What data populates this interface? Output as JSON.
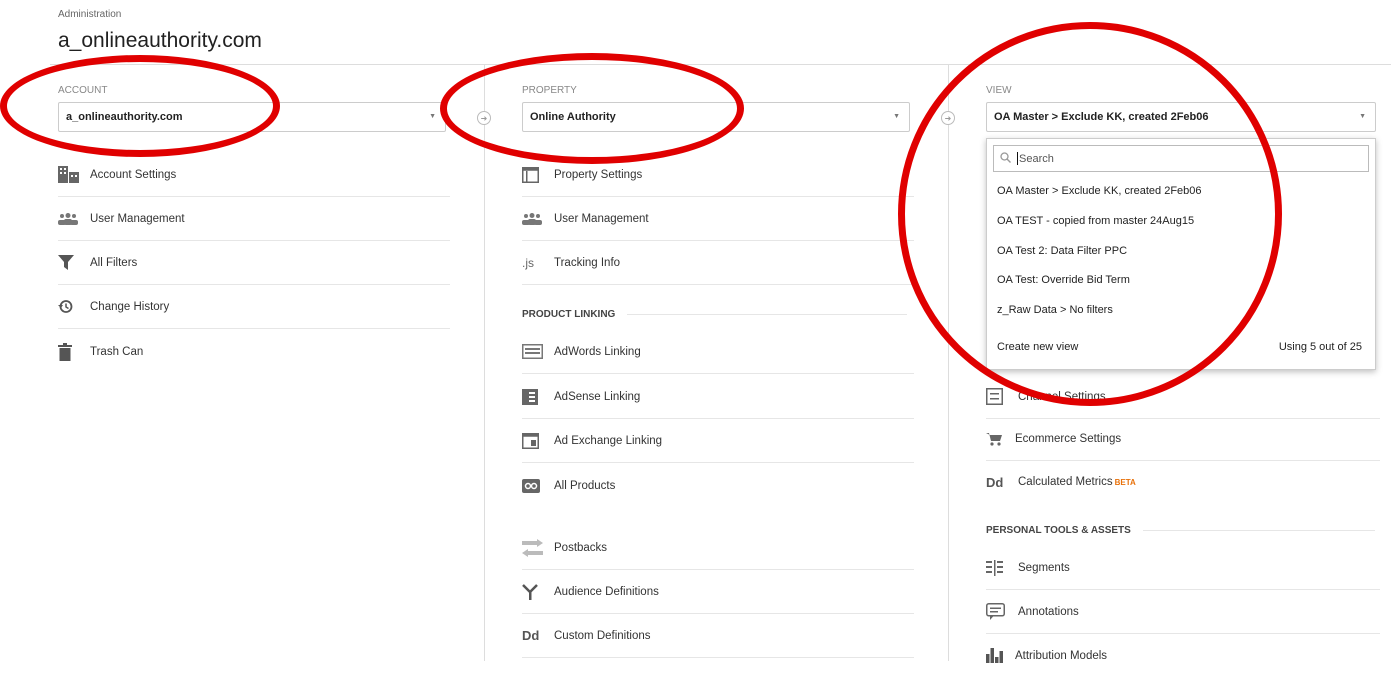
{
  "header": {
    "breadcrumb": "Administration",
    "title": "a_onlineauthority.com"
  },
  "account": {
    "label": "ACCOUNT",
    "selected": "a_onlineauthority.com",
    "items": [
      {
        "label": "Account Settings",
        "icon": "building-icon"
      },
      {
        "label": "User Management",
        "icon": "users-icon"
      },
      {
        "label": "All Filters",
        "icon": "filter-icon"
      },
      {
        "label": "Change History",
        "icon": "history-icon"
      },
      {
        "label": "Trash Can",
        "icon": "trash-icon"
      }
    ]
  },
  "property": {
    "label": "PROPERTY",
    "selected": "Online Authority",
    "items": [
      {
        "label": "Property Settings",
        "icon": "settings-window-icon"
      },
      {
        "label": "User Management",
        "icon": "users-icon"
      },
      {
        "label": "Tracking Info",
        "icon": "js-icon"
      }
    ],
    "section_product_linking": "PRODUCT LINKING",
    "linking": [
      {
        "label": "AdWords Linking",
        "icon": "adwords-icon"
      },
      {
        "label": "AdSense Linking",
        "icon": "adsense-icon"
      },
      {
        "label": "Ad Exchange Linking",
        "icon": "adexchange-icon"
      },
      {
        "label": "All Products",
        "icon": "link-products-icon"
      }
    ],
    "more": [
      {
        "label": "Postbacks",
        "icon": "postbacks-icon"
      },
      {
        "label": "Audience Definitions",
        "icon": "audience-icon"
      },
      {
        "label": "Custom Definitions",
        "icon": "dd-icon"
      }
    ]
  },
  "view": {
    "label": "VIEW",
    "selected": "OA Master > Exclude KK, created 2Feb06",
    "dropdown": {
      "search_placeholder": "Search",
      "search_first_letter": "S",
      "search_rest": "earch",
      "options": [
        "OA Master > Exclude KK, created 2Feb06",
        "OA TEST - copied from master 24Aug15",
        "OA Test 2: Data Filter PPC",
        "OA Test: Override Bid Term",
        "z_Raw Data > No filters"
      ],
      "create": "Create new view",
      "usage": "Using 5 out of 25"
    },
    "items": [
      {
        "label": "Channel Settings",
        "icon": "channel-icon"
      },
      {
        "label": "Ecommerce Settings",
        "icon": "cart-icon"
      },
      {
        "label": "Calculated Metrics",
        "icon": "dd-icon",
        "badge": "BETA"
      }
    ],
    "section_personal": "PERSONAL TOOLS & ASSETS",
    "personal": [
      {
        "label": "Segments",
        "icon": "segments-icon"
      },
      {
        "label": "Annotations",
        "icon": "annotation-icon"
      },
      {
        "label": "Attribution Models",
        "icon": "attribution-icon"
      }
    ]
  },
  "colors": {
    "annotation_red": "#e00000",
    "beta": "#e8710a"
  }
}
